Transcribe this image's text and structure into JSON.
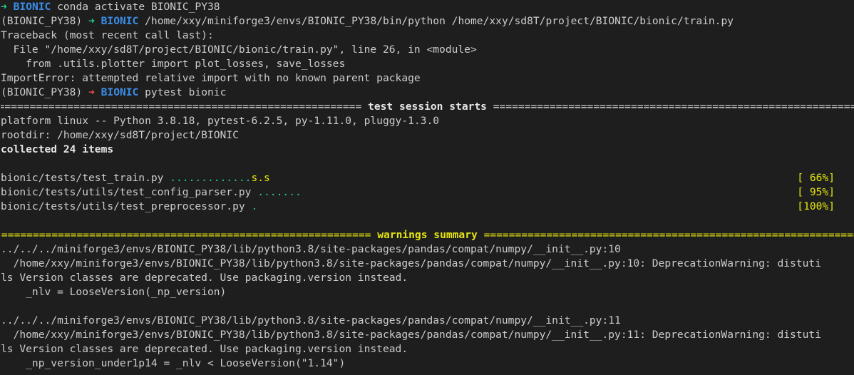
{
  "colors": {
    "background": "#1e1e1e",
    "text": "#cccccc",
    "prompt_arrow_ok": "#23d18b",
    "prompt_arrow_err": "#f14c4c",
    "prompt_dir": "#3b8eea",
    "pass_dot": "#23d18b",
    "skip": "#e5e510",
    "warning": "#e5e510"
  },
  "prompt1": {
    "arrow": "➜",
    "dir": "BIONIC",
    "command": "conda activate BIONIC_PY38"
  },
  "prompt2": {
    "env": "(BIONIC_PY38)",
    "arrow": "➜",
    "dir": "BIONIC",
    "command": "/home/xxy/miniforge3/envs/BIONIC_PY38/bin/python /home/xxy/sd8T/project/BIONIC/bionic/train.py"
  },
  "traceback": {
    "header": "Traceback (most recent call last):",
    "file": "  File \"/home/xxy/sd8T/project/BIONIC/bionic/train.py\", line 26, in <module>",
    "code": "    from .utils.plotter import plot_losses, save_losses",
    "error": "ImportError: attempted relative import with no known parent package"
  },
  "prompt3": {
    "env": "(BIONIC_PY38)",
    "arrow": "➜",
    "dir": "BIONIC",
    "command": "pytest bionic"
  },
  "session": {
    "separator_char": "=",
    "title": " test session starts ",
    "platform": "platform linux -- Python 3.8.18, pytest-6.2.5, py-1.11.0, pluggy-1.3.0",
    "rootdir": "rootdir: /home/xxy/sd8T/project/BIONIC",
    "collected": "collected 24 items"
  },
  "results": [
    {
      "file": "bionic/tests/test_train.py ",
      "dots": ".............",
      "skips": "s.s",
      "percent": "[ 66%]"
    },
    {
      "file": "bionic/tests/utils/test_config_parser.py ",
      "dots": ".......",
      "skips": "",
      "percent": "[ 95%]"
    },
    {
      "file": "bionic/tests/utils/test_preprocessor.py ",
      "dots": ".",
      "skips": "",
      "percent": "[100%]"
    }
  ],
  "warnings": {
    "title": " warnings summary ",
    "items": [
      {
        "location": "../../../miniforge3/envs/BIONIC_PY38/lib/python3.8/site-packages/pandas/compat/numpy/__init__.py:10",
        "message_1": "  /home/xxy/miniforge3/envs/BIONIC_PY38/lib/python3.8/site-packages/pandas/compat/numpy/__init__.py:10: DeprecationWarning: distuti",
        "message_2": "ls Version classes are deprecated. Use packaging.version instead.",
        "code": "    _nlv = LooseVersion(_np_version)"
      },
      {
        "location": "../../../miniforge3/envs/BIONIC_PY38/lib/python3.8/site-packages/pandas/compat/numpy/__init__.py:11",
        "message_1": "  /home/xxy/miniforge3/envs/BIONIC_PY38/lib/python3.8/site-packages/pandas/compat/numpy/__init__.py:11: DeprecationWarning: distuti",
        "message_2": "ls Version classes are deprecated. Use packaging.version instead.",
        "code": "    _np_version_under1p14 = _nlv < LooseVersion(\"1.14\")"
      }
    ]
  }
}
